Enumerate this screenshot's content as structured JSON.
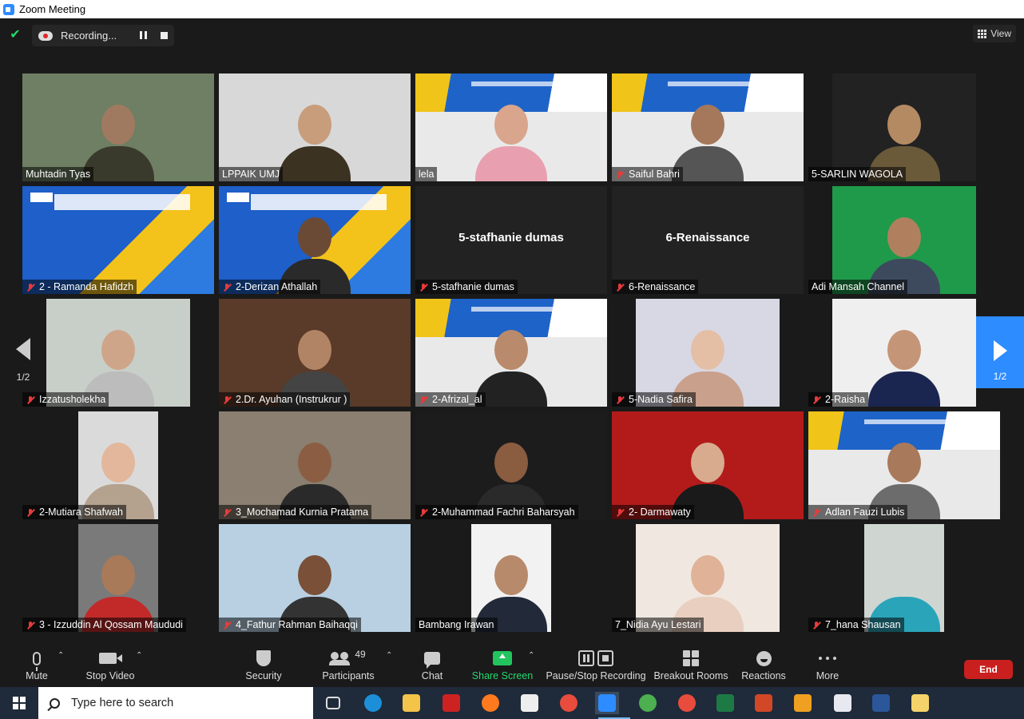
{
  "window": {
    "title": "Zoom Meeting"
  },
  "recording": {
    "label": "Recording..."
  },
  "view": {
    "label": "View"
  },
  "pagination": {
    "left": "1/2",
    "right": "1/2"
  },
  "participants": [
    {
      "name": "Muhtadin Tyas",
      "muted": false,
      "bg": "#6e7f63",
      "skin": "#a07a60",
      "shirt": "#3a3a2c",
      "kind": "video"
    },
    {
      "name": "LPPAIK UMJ",
      "muted": false,
      "bg": "#d8d8d8",
      "skin": "#c89d7c",
      "shirt": "#3c3222",
      "kind": "video"
    },
    {
      "name": "lela",
      "muted": false,
      "bg": "#e9e9e9",
      "skin": "#d9a58c",
      "shirt": "#e8a0b0",
      "kind": "banner"
    },
    {
      "name": "Saiful Bahri",
      "muted": true,
      "bg": "#e9e9e9",
      "skin": "#a5785c",
      "shirt": "#555555",
      "kind": "banner"
    },
    {
      "name": "5-SARLIN WAGOLA",
      "muted": false,
      "bg": "#222222",
      "skin": "#b48a63",
      "shirt": "#6a5a3a",
      "kind": "video-narrow",
      "active": true
    },
    {
      "name": "2 - Ramanda Hafidzh",
      "muted": true,
      "bg": "#1e5fc9",
      "kind": "slide"
    },
    {
      "name": "2-Derizan Athallah",
      "muted": true,
      "bg": "#1e5fc9",
      "skin": "#6b4a35",
      "shirt": "#2a2a2a",
      "kind": "slide-person"
    },
    {
      "name": "5-stafhanie dumas",
      "muted": true,
      "kind": "name-only"
    },
    {
      "name": "6-Renaissance",
      "muted": true,
      "kind": "name-only"
    },
    {
      "name": "Adi Mansah Channel",
      "muted": false,
      "bg": "#1f9a4a",
      "skin": "#b0805e",
      "shirt": "#3d4a5e",
      "kind": "video-narrow"
    },
    {
      "name": "Izzatusholekha",
      "muted": true,
      "bg": "#c8cfc8",
      "skin": "#cfa58a",
      "shirt": "#bcbcbc",
      "kind": "video-narrow"
    },
    {
      "name": "2.Dr. Ayuhan (Instrukrur )",
      "muted": true,
      "bg": "#5a3a28",
      "skin": "#b28466",
      "shirt": "#444444",
      "kind": "video"
    },
    {
      "name": "2-Afrizal_al",
      "muted": true,
      "bg": "#e9e9e9",
      "skin": "#b98b6c",
      "shirt": "#222222",
      "kind": "banner"
    },
    {
      "name": "5-Nadia Safira",
      "muted": true,
      "bg": "#d8d8e4",
      "skin": "#e4bfa5",
      "shirt": "#c9a08c",
      "kind": "video-narrow"
    },
    {
      "name": "2-Raisha",
      "muted": true,
      "bg": "#efefef",
      "skin": "#c59578",
      "shirt": "#1a2650",
      "kind": "video-narrow"
    },
    {
      "name": "2-Mutiara Shafwah",
      "muted": true,
      "bg": "#dadada",
      "skin": "#e2b79c",
      "shirt": "#b4a28e",
      "kind": "video-small"
    },
    {
      "name": "3_Mochamad Kurnia Pratama",
      "muted": true,
      "bg": "#8a7f70",
      "skin": "#8b5e43",
      "shirt": "#2a2a2a",
      "kind": "video"
    },
    {
      "name": "2-Muhammad Fachri Baharsyah",
      "muted": true,
      "bg": "#1c1c1c",
      "skin": "#8a5c40",
      "shirt": "#2a2a2a",
      "kind": "video"
    },
    {
      "name": "2- Darmawaty",
      "muted": true,
      "bg": "#b31b1b",
      "skin": "#d8ab8e",
      "shirt": "#1a1a1a",
      "kind": "video"
    },
    {
      "name": "Adlan Fauzi Lubis",
      "muted": true,
      "bg": "#1e63c8",
      "skin": "#a9795b",
      "shirt": "#6c6c6c",
      "kind": "banner"
    },
    {
      "name": "3 - Izzuddin Al Qossam Maududi",
      "muted": true,
      "bg": "#7a7a7a",
      "skin": "#a87a5a",
      "shirt": "#c22a2a",
      "kind": "video-small"
    },
    {
      "name": "4_Fathur Rahman Baihaqqi",
      "muted": true,
      "bg": "#b8d0e2",
      "skin": "#7a5038",
      "shirt": "#333333",
      "kind": "video"
    },
    {
      "name": "Bambang Irawan",
      "muted": false,
      "bg": "#f2f2f2",
      "skin": "#b78a6b",
      "shirt": "#222a3a",
      "kind": "video-small"
    },
    {
      "name": "7_Nidia Ayu Lestari",
      "muted": false,
      "bg": "#f0e8e0",
      "skin": "#e0b298",
      "shirt": "#e8cfc0",
      "kind": "video-narrow"
    },
    {
      "name": "7_hana Shausan",
      "muted": true,
      "bg": "#cfd6d2",
      "skin": "#cfd6d2",
      "shirt": "#2aa4b8",
      "kind": "video-small"
    }
  ],
  "toolbar": {
    "mute": "Mute",
    "stop_video": "Stop Video",
    "security": "Security",
    "participants": "Participants",
    "participants_count": "49",
    "chat": "Chat",
    "share_screen": "Share Screen",
    "pause_recording": "Pause/Stop Recording",
    "breakout_rooms": "Breakout Rooms",
    "reactions": "Reactions",
    "more": "More",
    "end": "End"
  },
  "taskbar": {
    "search_placeholder": "Type here to search",
    "apps": [
      {
        "icon": "task-view-icon",
        "color": "#1f2b3a"
      },
      {
        "icon": "edge-icon",
        "color": "#1c8fd8"
      },
      {
        "icon": "file-explorer-icon",
        "color": "#f3c34a"
      },
      {
        "icon": "red-app-icon",
        "color": "#cc2222"
      },
      {
        "icon": "firefox-icon",
        "color": "#ff7a1f"
      },
      {
        "icon": "store-icon",
        "color": "#eeeeee"
      },
      {
        "icon": "chrome-icon",
        "color": "#e84c3d"
      },
      {
        "icon": "zoom-icon",
        "color": "#2d8cff"
      },
      {
        "icon": "chrome-profile-icon",
        "color": "#4caf50"
      },
      {
        "icon": "chrome-profile-2-icon",
        "color": "#e84c3d"
      },
      {
        "icon": "excel-icon",
        "color": "#1d7a45"
      },
      {
        "icon": "powerpoint-icon",
        "color": "#d24726"
      },
      {
        "icon": "video-player-icon",
        "color": "#f0a020"
      },
      {
        "icon": "paint-icon",
        "color": "#e8e8f0"
      },
      {
        "icon": "word-icon",
        "color": "#2b579a"
      },
      {
        "icon": "image-viewer-icon",
        "color": "#f5d36a"
      }
    ]
  }
}
